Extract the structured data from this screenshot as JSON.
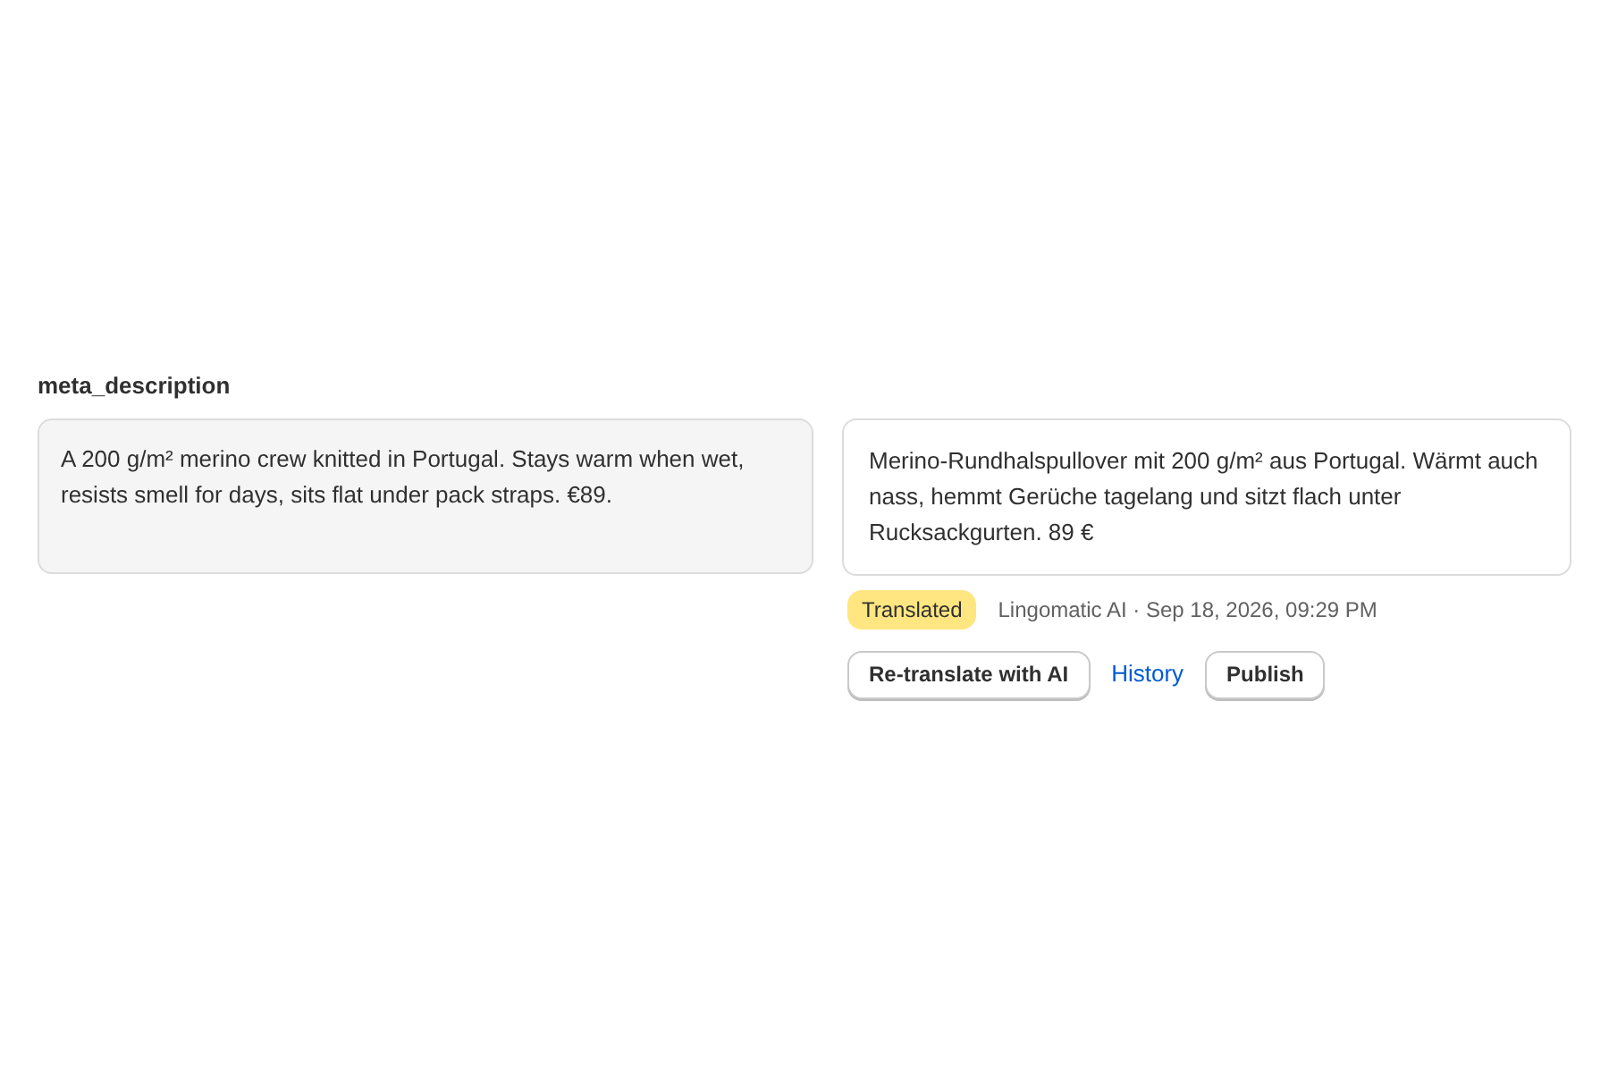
{
  "field": {
    "label": "meta_description"
  },
  "source": {
    "text": "A 200 g/m² merino crew knitted in Portugal. Stays warm when wet, resists smell for days, sits flat under pack straps. €89."
  },
  "translation": {
    "text": "Merino-Rundhalspullover mit 200 g/m² aus Portugal. Wärmt auch nass, hemmt Gerüche tagelang und sitzt flach unter Rucksackgurten. 89 €",
    "status": "Translated",
    "meta": "Lingomatic AI · Sep 18, 2026, 09:29 PM"
  },
  "actions": [
    {
      "kind": "button",
      "label": "Re-translate with AI"
    },
    {
      "kind": "link",
      "label": "History"
    },
    {
      "kind": "button",
      "label": "Publish"
    }
  ]
}
